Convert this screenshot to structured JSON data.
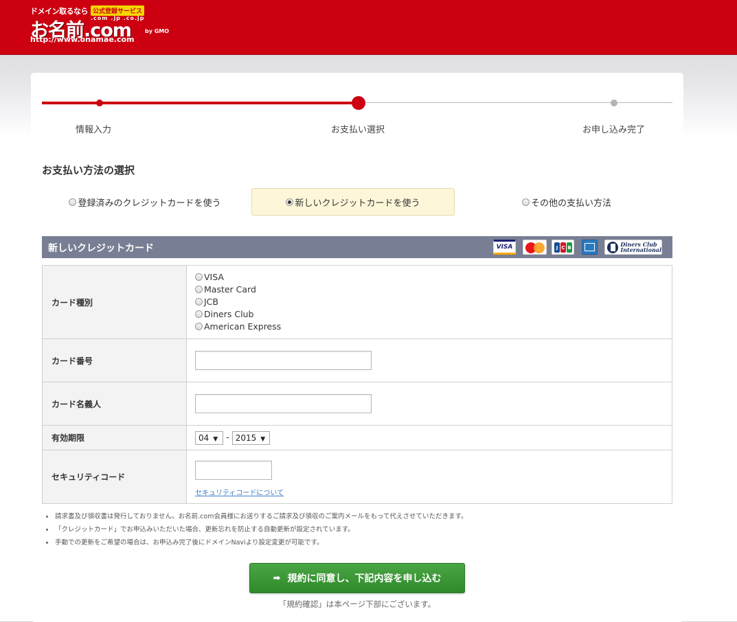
{
  "header": {
    "logo_tagline": "ドメイン取るなら",
    "logo_badge": "公式登録サービス",
    "logo_tlds": ".com .jp .co.jp",
    "logo_brand": "お名前.com",
    "logo_by": "by GMO",
    "logo_url": "http://www.onamae.com",
    "bg_color": "#cc0010"
  },
  "progress": {
    "steps": [
      {
        "label": "情報入力",
        "state": "done"
      },
      {
        "label": "お支払い選択",
        "state": "current"
      },
      {
        "label": "お申し込み完了",
        "state": "todo"
      }
    ]
  },
  "section_title": "お支払い方法の選択",
  "payment_methods": [
    {
      "label": "登録済みのクレジットカードを使う",
      "selected": false
    },
    {
      "label": "新しいクレジットカードを使う",
      "selected": true
    },
    {
      "label": "その他の支払い方法",
      "selected": false
    }
  ],
  "credit_card": {
    "bar_title": "新しいクレジットカード",
    "card_logos": {
      "visa": "VISA",
      "mastercard_icon": "mastercard-icon",
      "jcb": [
        "J",
        "C",
        "B"
      ],
      "amex_icon": "amex-icon",
      "diners_line1": "Diners Club",
      "diners_line2": "International"
    },
    "rows": {
      "type_label": "カード種別",
      "type_options": [
        "VISA",
        "Master Card",
        "JCB",
        "Diners Club",
        "American Express"
      ],
      "number_label": "カード番号",
      "number_value": "",
      "name_label": "カード名義人",
      "name_value": "",
      "expiry_label": "有効期限",
      "expiry_month": "04",
      "expiry_separator": "-",
      "expiry_year": "2015",
      "security_label": "セキュリティコード",
      "security_value": "",
      "security_link": "セキュリティコードについて"
    }
  },
  "notes": [
    "請求書及び領収書は発行しておりません。お名前.com会員様にお送りするご請求及び領収のご案内メールをもって代えさせていただきます。",
    "「クレジットカード」でお申込みいただいた場合、更新忘れを防止する自動更新が設定されています。",
    "手動での更新をご希望の場合は、お申込み完了後にドメインNaviより設定変更が可能です。"
  ],
  "submit": {
    "label": "規約に同意し、下記内容を申し込む",
    "icon": "arrow-right-icon",
    "color": "#3a9a35"
  },
  "agree_note": "「規約確認」は本ページ下部にございます。"
}
